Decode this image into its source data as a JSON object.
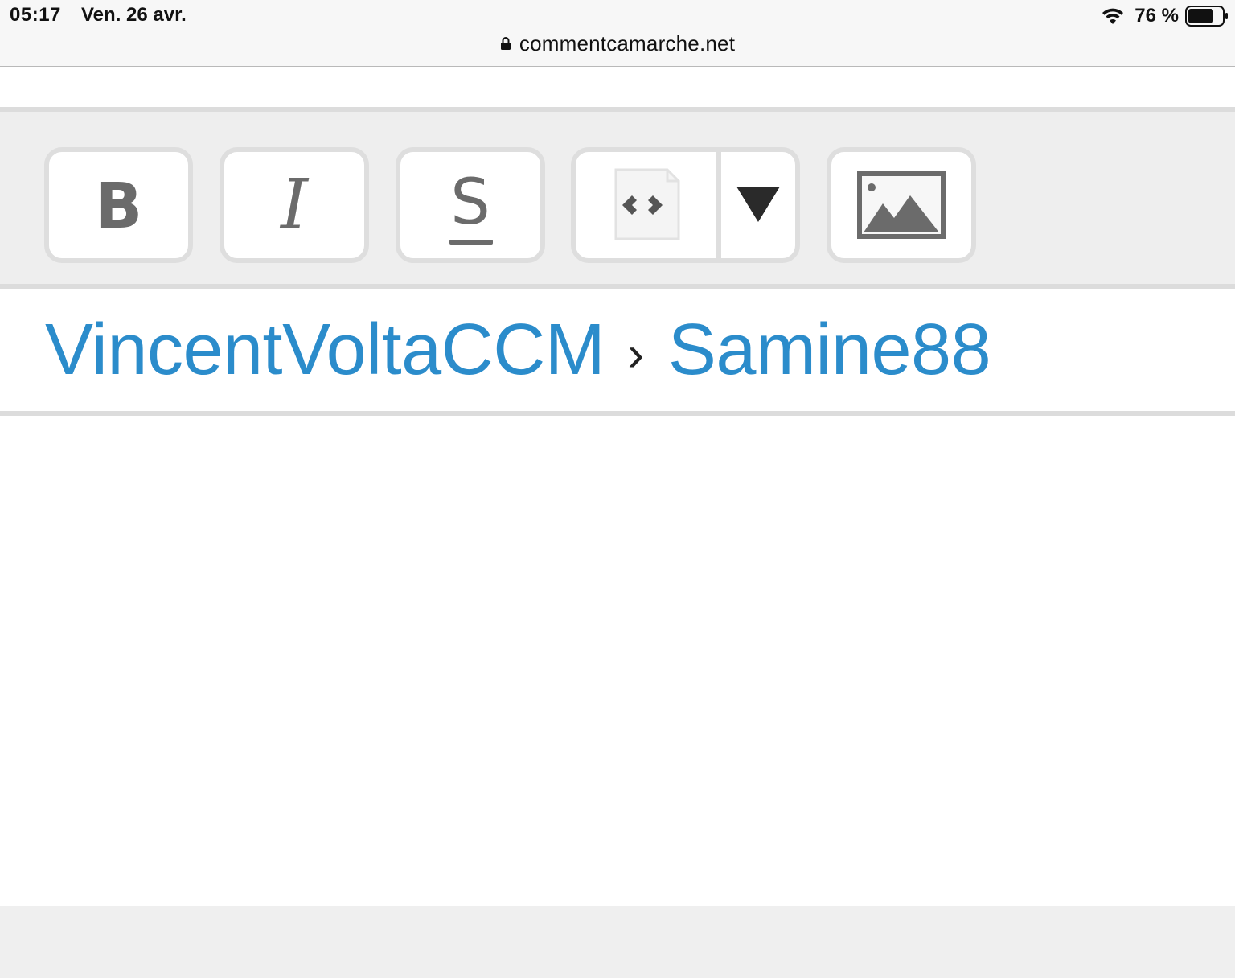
{
  "status_bar": {
    "time": "05:17",
    "date": "Ven. 26 avr.",
    "battery_percent": "76 %",
    "battery_level": 0.76,
    "icons": [
      "wifi-icon",
      "battery-icon",
      "lock-icon"
    ]
  },
  "browser": {
    "url": "commentcamarche.net"
  },
  "toolbar": {
    "buttons": [
      {
        "name": "bold",
        "glyph": "B"
      },
      {
        "name": "italic",
        "glyph": "I"
      },
      {
        "name": "strikethrough",
        "glyph": "S"
      },
      {
        "name": "code-block",
        "icon": "code-file-icon"
      },
      {
        "name": "image",
        "icon": "image-icon"
      }
    ]
  },
  "breadcrumb": {
    "items": [
      "VincentVoltaCCM",
      "Samine88"
    ],
    "separator": "›"
  },
  "colors": {
    "link": "#2b8ccb",
    "toolbar_bg": "#eeeeee",
    "button_border": "#dedede",
    "icon_gray": "#6b6b6b"
  }
}
